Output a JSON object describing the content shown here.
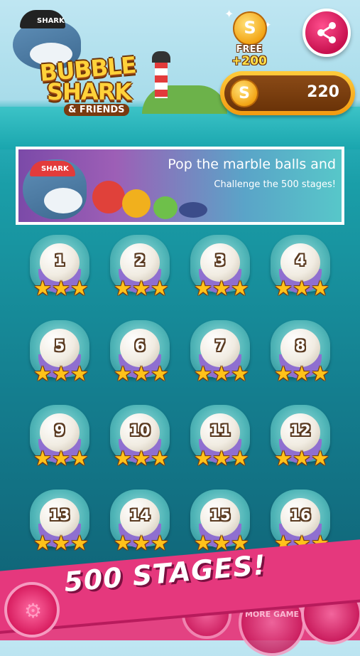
{
  "logo": {
    "cap_text": "SHARK",
    "title_line1": "BUBBLE",
    "title_line2": "SHARK",
    "subtitle": "& FRIENDS"
  },
  "free_coins": {
    "coin_letter": "S",
    "label": "FREE",
    "amount": "+200"
  },
  "coin_balance": {
    "coin_letter": "S",
    "count": "220"
  },
  "share": {
    "icon": "share-icon"
  },
  "banner": {
    "cap_text": "SHARK",
    "line1": "Pop the marble balls and",
    "line2": "Challenge the 500 stages!"
  },
  "stages": [
    {
      "number": "1",
      "stars": 3
    },
    {
      "number": "2",
      "stars": 3
    },
    {
      "number": "3",
      "stars": 3
    },
    {
      "number": "4",
      "stars": 3
    },
    {
      "number": "5",
      "stars": 3
    },
    {
      "number": "6",
      "stars": 3
    },
    {
      "number": "7",
      "stars": 3
    },
    {
      "number": "8",
      "stars": 3
    },
    {
      "number": "9",
      "stars": 3
    },
    {
      "number": "10",
      "stars": 3
    },
    {
      "number": "11",
      "stars": 3
    },
    {
      "number": "12",
      "stars": 3
    },
    {
      "number": "13",
      "stars": 3
    },
    {
      "number": "14",
      "stars": 3
    },
    {
      "number": "15",
      "stars": 3
    },
    {
      "number": "16",
      "stars": 3
    }
  ],
  "promo": {
    "ribbon": "500 STAGES!"
  },
  "bottom": {
    "settings_icon": "gear-icon",
    "more_game": "MORE GAME"
  },
  "colors": {
    "accent_pink": "#e5387d",
    "gold": "#ffc21a",
    "sea": "#1a9ea8"
  }
}
